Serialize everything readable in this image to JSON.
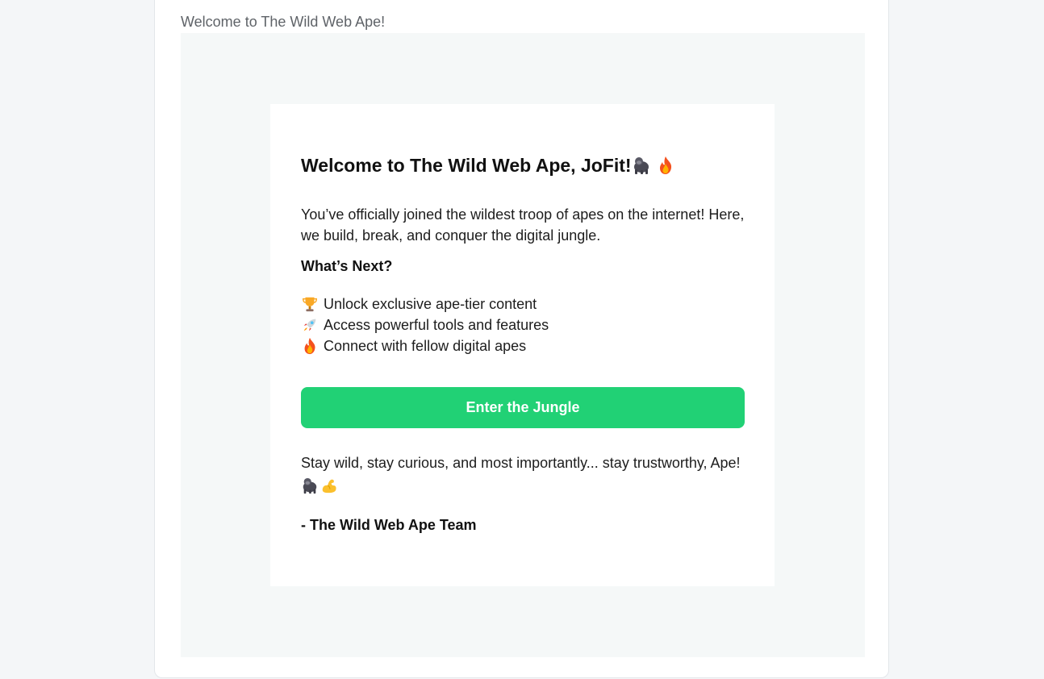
{
  "email": {
    "preheader": "Welcome to The Wild Web Ape!",
    "headline": "Welcome to The Wild Web Ape, JoFit!",
    "headline_icons": [
      "gorilla-icon",
      "fire-icon"
    ],
    "intro": "You’ve officially joined the wildest troop of apes on the internet! Here, we build, break, and conquer the digital jungle.",
    "next_heading": "What’s Next?",
    "features": [
      {
        "icon": "trophy-icon",
        "label": "Unlock exclusive ape-tier content"
      },
      {
        "icon": "rocket-icon",
        "label": "Access powerful tools and features"
      },
      {
        "icon": "fire-icon",
        "label": "Connect with fellow digital apes"
      }
    ],
    "cta_label": "Enter the Jungle",
    "outro": "Stay wild, stay curious, and most importantly... stay trustworthy, Ape!",
    "outro_icons": [
      "gorilla-icon",
      "flexed-biceps-icon"
    ],
    "signoff": "- The Wild Web Ape Team"
  },
  "colors": {
    "cta": "#21d175",
    "card_background": "#ffffff",
    "email_background": "#f5f8f8",
    "page_background": "#f4f6f8"
  }
}
